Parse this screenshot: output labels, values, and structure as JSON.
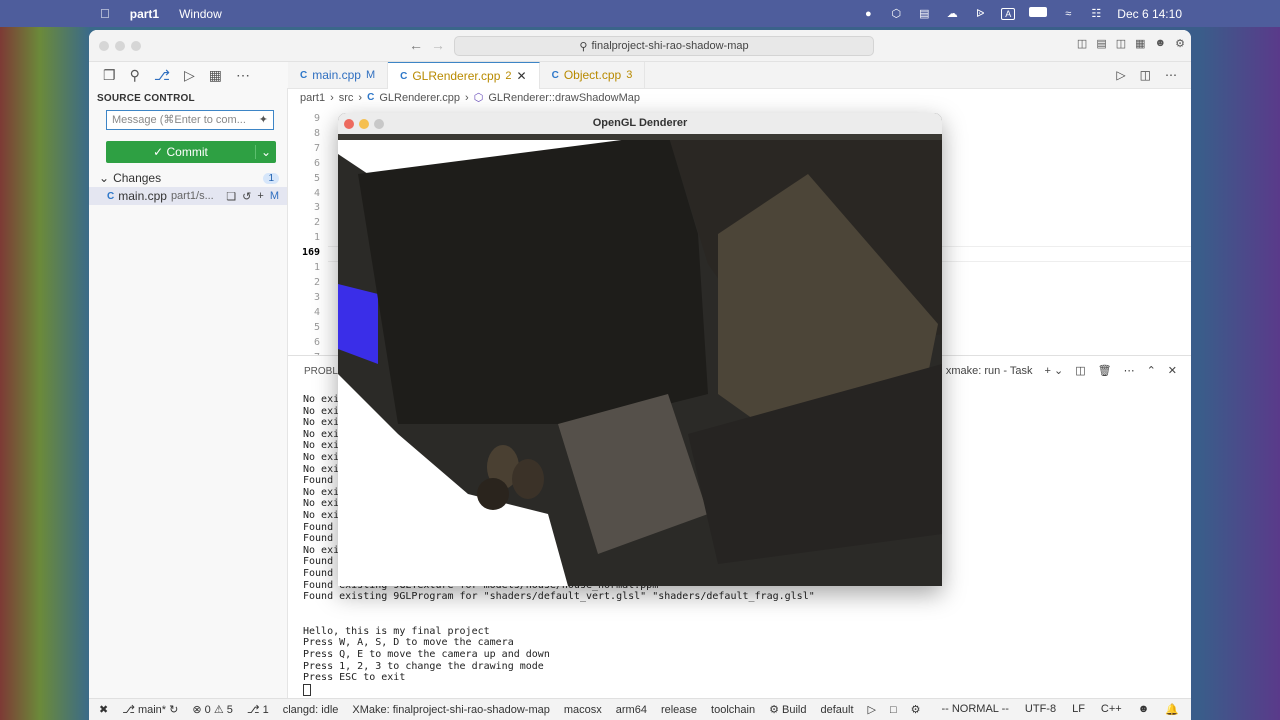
{
  "menubar": {
    "app": "part1",
    "menu": "Window",
    "datetime": "Dec 6  14:10",
    "input_indicator": "A"
  },
  "titlebar": {
    "search": "finalproject-shi-rao-shadow-map"
  },
  "sidebar": {
    "title": "SOURCE CONTROL",
    "message_placeholder": "Message (⌘Enter to com...",
    "commit_label": "✓ Commit",
    "changes_label": "Changes",
    "changes_count": "1",
    "file_name": "main.cpp",
    "file_path": "part1/s...",
    "file_status": "M"
  },
  "tabs": [
    {
      "label": "main.cpp",
      "status": "M"
    },
    {
      "label": "GLRenderer.cpp",
      "status": "2"
    },
    {
      "label": "Object.cpp",
      "status": "3"
    }
  ],
  "breadcrumb": {
    "seg1": "part1",
    "seg2": "src",
    "seg3": "GLRenderer.cpp",
    "seg4": "GLRenderer::drawShadowMap"
  },
  "editor": {
    "line_numbers": [
      "9",
      "8",
      "7",
      "6",
      "5",
      "4",
      "3",
      "2",
      "1",
      "169",
      "1",
      "2",
      "3",
      "4",
      "5",
      "6",
      "7"
    ]
  },
  "panel": {
    "tab": "PROBLE",
    "task": "xmake: run - Task",
    "terminal_lines": [
      "No exi",
      "No exi",
      "No exi",
      "No exi",
      "No exi",
      "No exi",
      "No exi",
      "Found",
      "No exi",
      "No exi",
      "No exi",
      "Found",
      "Found",
      "No exi",
      "Found",
      "Found",
      "Found existing 9GLTexture for models/house/house_normal.ppm",
      "Found existing 9GLProgram for \"shaders/default_vert.glsl\" \"shaders/default_frag.glsl\"",
      "",
      "",
      "Hello, this is my final project",
      "Press W, A, S, D to move the camera",
      "Press Q, E to move the camera up and down",
      "Press 1, 2, 3 to change the drawing mode",
      "Press ESC to exit"
    ]
  },
  "gl_window": {
    "title": "OpenGL Denderer"
  },
  "statusbar": {
    "branch": "main*",
    "errors": "0",
    "warnings": "5",
    "ports": "1",
    "clangd": "clangd: idle",
    "xmake": "XMake: finalproject-shi-rao-shadow-map",
    "platform": "macosx",
    "arch": "arm64",
    "mode": "release",
    "toolchain": "toolchain",
    "build": "Build",
    "target": "default",
    "vim_mode": "-- NORMAL --",
    "encoding": "UTF-8",
    "eol": "LF",
    "language": "C++"
  }
}
